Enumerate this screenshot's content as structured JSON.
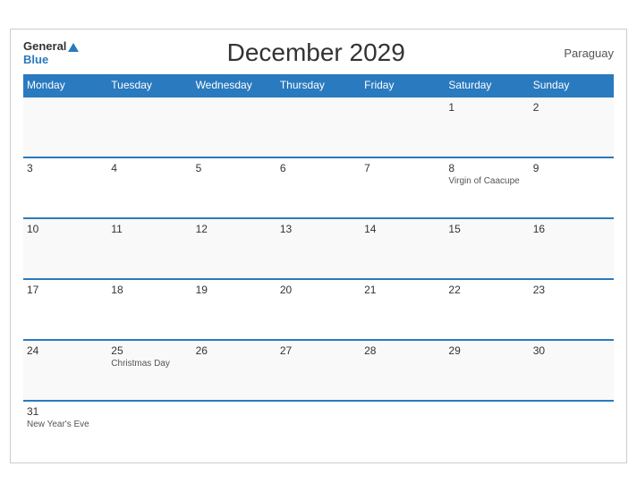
{
  "header": {
    "title": "December 2029",
    "country": "Paraguay",
    "logo_general": "General",
    "logo_blue": "Blue"
  },
  "days_of_week": [
    "Monday",
    "Tuesday",
    "Wednesday",
    "Thursday",
    "Friday",
    "Saturday",
    "Sunday"
  ],
  "weeks": [
    [
      {
        "day": "",
        "event": ""
      },
      {
        "day": "",
        "event": ""
      },
      {
        "day": "",
        "event": ""
      },
      {
        "day": "",
        "event": ""
      },
      {
        "day": "",
        "event": ""
      },
      {
        "day": "1",
        "event": ""
      },
      {
        "day": "2",
        "event": ""
      }
    ],
    [
      {
        "day": "3",
        "event": ""
      },
      {
        "day": "4",
        "event": ""
      },
      {
        "day": "5",
        "event": ""
      },
      {
        "day": "6",
        "event": ""
      },
      {
        "day": "7",
        "event": ""
      },
      {
        "day": "8",
        "event": "Virgin of Caacupe"
      },
      {
        "day": "9",
        "event": ""
      }
    ],
    [
      {
        "day": "10",
        "event": ""
      },
      {
        "day": "11",
        "event": ""
      },
      {
        "day": "12",
        "event": ""
      },
      {
        "day": "13",
        "event": ""
      },
      {
        "day": "14",
        "event": ""
      },
      {
        "day": "15",
        "event": ""
      },
      {
        "day": "16",
        "event": ""
      }
    ],
    [
      {
        "day": "17",
        "event": ""
      },
      {
        "day": "18",
        "event": ""
      },
      {
        "day": "19",
        "event": ""
      },
      {
        "day": "20",
        "event": ""
      },
      {
        "day": "21",
        "event": ""
      },
      {
        "day": "22",
        "event": ""
      },
      {
        "day": "23",
        "event": ""
      }
    ],
    [
      {
        "day": "24",
        "event": ""
      },
      {
        "day": "25",
        "event": "Christmas Day"
      },
      {
        "day": "26",
        "event": ""
      },
      {
        "day": "27",
        "event": ""
      },
      {
        "day": "28",
        "event": ""
      },
      {
        "day": "29",
        "event": ""
      },
      {
        "day": "30",
        "event": ""
      }
    ],
    [
      {
        "day": "31",
        "event": "New Year's Eve"
      },
      {
        "day": "",
        "event": ""
      },
      {
        "day": "",
        "event": ""
      },
      {
        "day": "",
        "event": ""
      },
      {
        "day": "",
        "event": ""
      },
      {
        "day": "",
        "event": ""
      },
      {
        "day": "",
        "event": ""
      }
    ]
  ]
}
